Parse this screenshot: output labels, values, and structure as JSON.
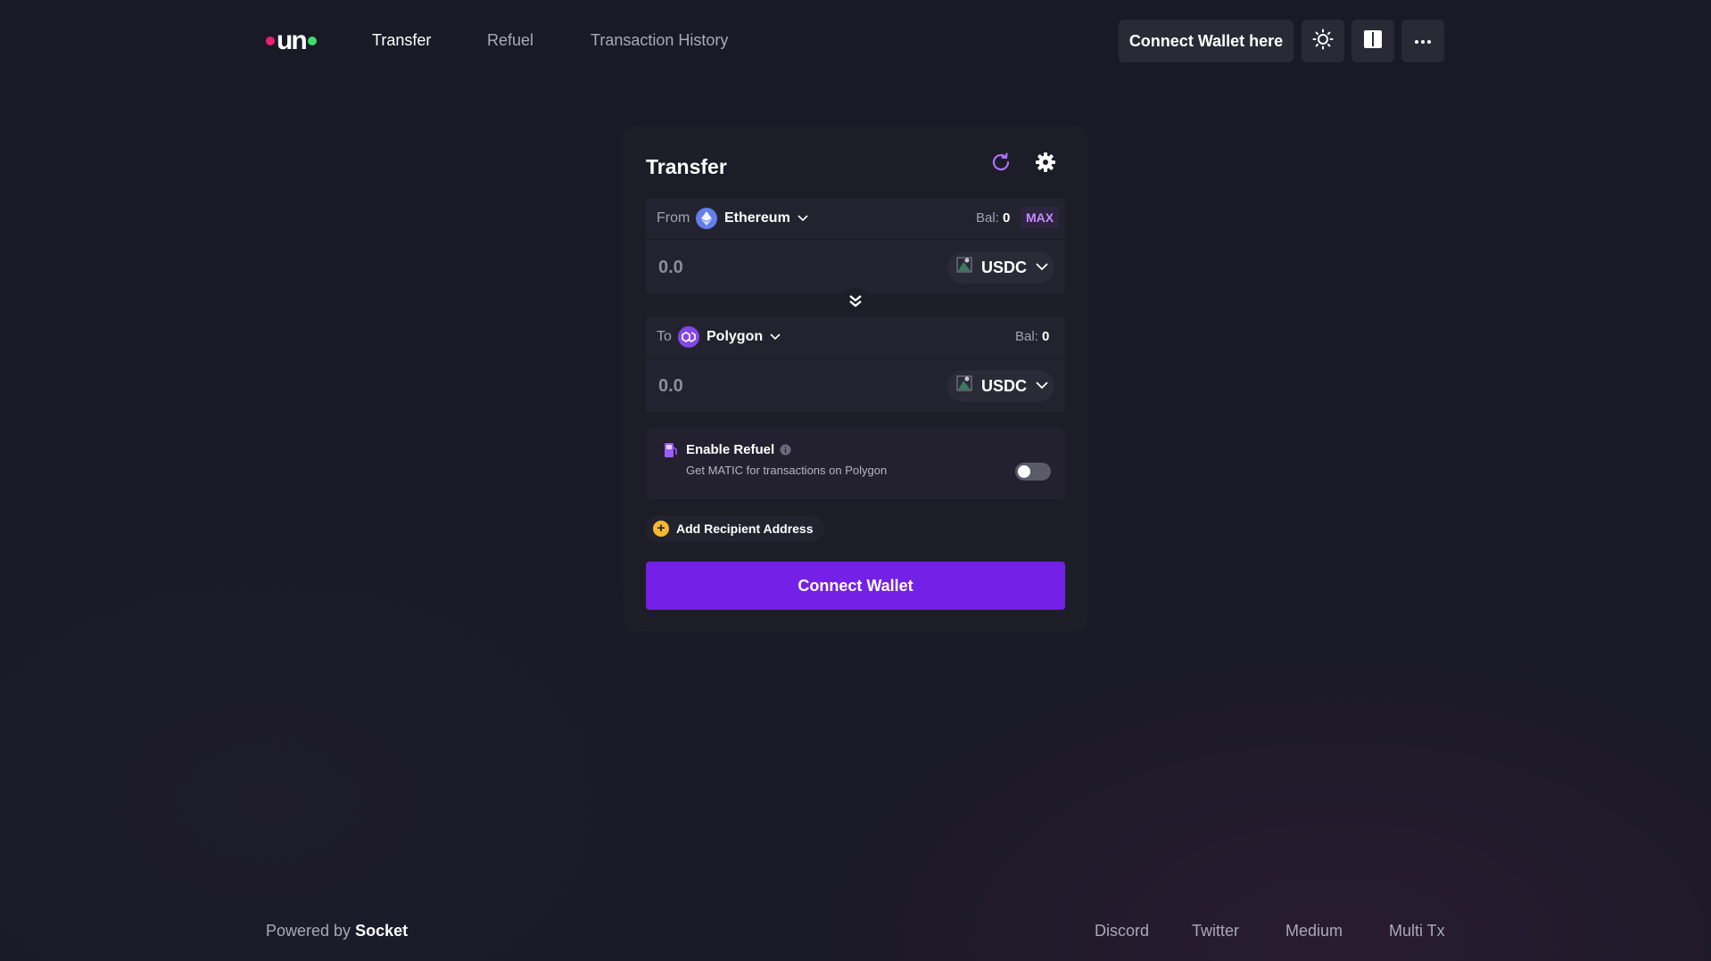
{
  "header": {
    "logo_text": "un",
    "nav": [
      {
        "label": "Transfer",
        "active": true
      },
      {
        "label": "Refuel",
        "active": false
      },
      {
        "label": "Transaction History",
        "active": false
      }
    ],
    "connect_wallet_label": "Connect Wallet here",
    "icons": [
      "sun-icon",
      "layout-icon",
      "more-icon"
    ]
  },
  "transfer": {
    "title": "Transfer",
    "from": {
      "label": "From",
      "chain": "Ethereum",
      "balance_label": "Bal:",
      "balance_value": "0",
      "max_label": "MAX",
      "amount_placeholder": "0.0",
      "token": "USDC"
    },
    "to": {
      "label": "To",
      "chain": "Polygon",
      "balance_label": "Bal:",
      "balance_value": "0",
      "amount_placeholder": "0.0",
      "token": "USDC"
    },
    "refuel": {
      "title": "Enable Refuel",
      "subtitle": "Get MATIC for transactions on Polygon",
      "enabled": false
    },
    "add_recipient_label": "Add Recipient Address",
    "connect_wallet_label": "Connect Wallet"
  },
  "footer": {
    "powered_by": "Powered by",
    "brand": "Socket",
    "links": [
      "Discord",
      "Twitter",
      "Medium",
      "Multi Tx"
    ]
  },
  "colors": {
    "background": "#1a1a26",
    "card": "#1d1d28",
    "accent": "#7420e6",
    "max_text": "#c58cff",
    "ethereum": "#627eea",
    "polygon": "#8247e5",
    "logo_pink": "#e8216f",
    "logo_green": "#3ddc6b"
  }
}
